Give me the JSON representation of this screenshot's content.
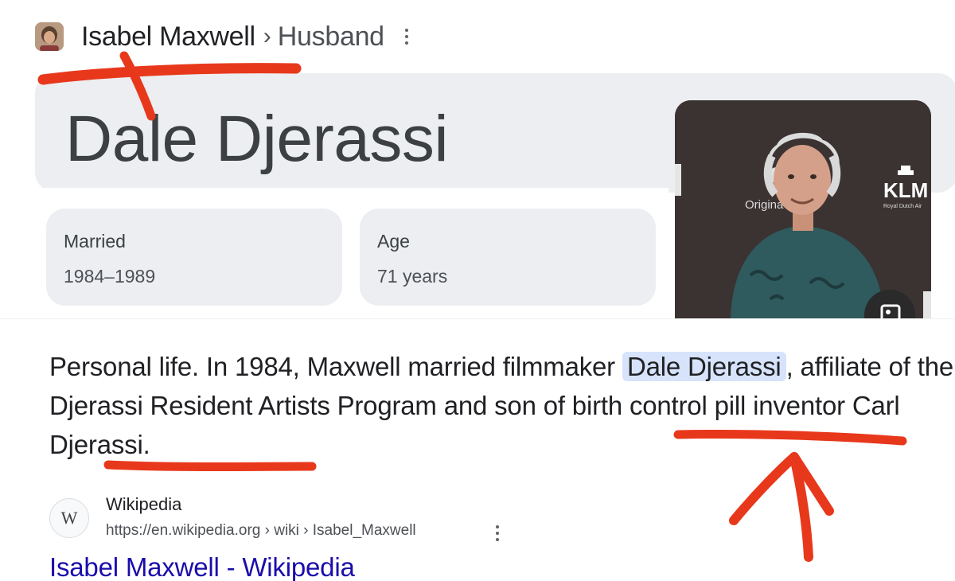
{
  "header": {
    "entity": "Isabel Maxwell",
    "separator": "›",
    "relation": "Husband"
  },
  "knowledge_panel": {
    "title": "Dale Djerassi",
    "facts": [
      {
        "label": "Married",
        "value": "1984–1989"
      },
      {
        "label": "Age",
        "value": "71 years"
      }
    ],
    "photo_partial_text": {
      "brand_left": "Origina",
      "brand_right": "KLM",
      "brand_right_sub": "Royal Dutch Air"
    }
  },
  "snippet": {
    "before": "Personal life. In 1984, Maxwell married filmmaker ",
    "highlight": "Dale Djerassi",
    "after": ", affiliate of the Djerassi Resident Artists Program and son of birth control pill inventor Carl Djerassi."
  },
  "result": {
    "source_name": "Wikipedia",
    "logo_letter": "W",
    "url": "https://en.wikipedia.org › wiki › Isabel_Maxwell",
    "link_title": "Isabel Maxwell - Wikipedia"
  },
  "icons": {
    "avatar": "person-avatar",
    "more": "more-vert-icon",
    "image_search": "image-search-icon"
  },
  "colors": {
    "link": "#1a0dab",
    "highlight": "#d6e3fb",
    "panel": "#eceef1",
    "annotation": "#e8381c"
  }
}
